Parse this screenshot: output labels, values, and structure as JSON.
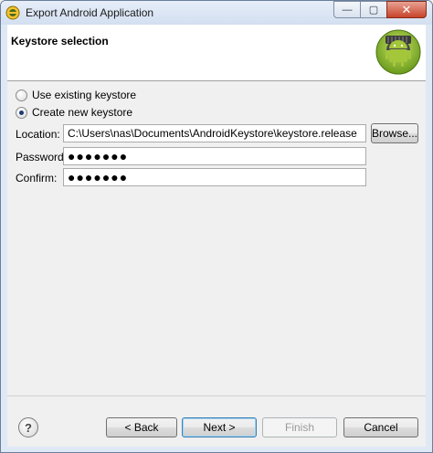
{
  "window": {
    "title": "Export Android Application",
    "minimize_glyph": "—",
    "maximize_glyph": "▢",
    "close_glyph": "✕"
  },
  "header": {
    "title": "Keystore selection",
    "logo_icon": "android-logo-icon"
  },
  "options": {
    "use_existing": {
      "label": "Use existing keystore",
      "checked": false
    },
    "create_new": {
      "label": "Create new keystore",
      "checked": true
    }
  },
  "form": {
    "location_label": "Location:",
    "location_value": "C:\\Users\\nas\\Documents\\AndroidKeystore\\keystore.release",
    "browse_label": "Browse...",
    "password_label": "Password:",
    "password_value": "●●●●●●●",
    "confirm_label": "Confirm:",
    "confirm_value": "●●●●●●●"
  },
  "footer": {
    "help_icon": "help-icon",
    "help_glyph": "?",
    "back_label": "< Back",
    "next_label": "Next >",
    "finish_label": "Finish",
    "cancel_label": "Cancel"
  },
  "colors": {
    "accent": "#3c7fb1",
    "android_green": "#a4c639"
  }
}
